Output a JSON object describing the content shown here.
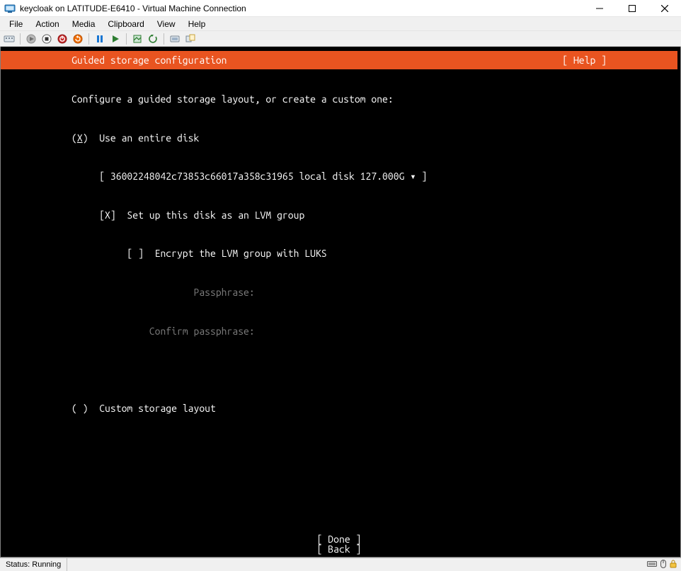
{
  "window": {
    "title": "keycloak on LATITUDE-E6410 - Virtual Machine Connection"
  },
  "menu": {
    "items": [
      "File",
      "Action",
      "Media",
      "Clipboard",
      "View",
      "Help"
    ]
  },
  "toolbar": {
    "icons": [
      "ctrl-alt-del-icon",
      "sep",
      "start-grey-icon",
      "stop-icon",
      "shutdown-icon",
      "reset-icon",
      "sep",
      "pause-icon",
      "resume-icon",
      "sep",
      "checkpoint-icon",
      "revert-icon",
      "sep",
      "enhanced-session-icon",
      "share-icon"
    ]
  },
  "installer": {
    "header_title": "Guided storage configuration",
    "header_help": "[ Help ]",
    "intro": "Configure a guided storage layout, or create a custom one:",
    "opt_entire_marker_pre": "(",
    "opt_entire_marker_key": "X",
    "opt_entire_marker_post": ")",
    "opt_entire_label": "Use an entire disk",
    "disk_select": "[ 36002248042c73853c66017a358c31965 local disk 127.000G ▾ ]",
    "lvm_check": "[X]  Set up this disk as an LVM group",
    "luks_check": "[ ]  Encrypt the LVM group with LUKS",
    "passphrase_label": "Passphrase:",
    "confirm_label": "Confirm passphrase:",
    "opt_custom_marker": "( )",
    "opt_custom_label": "Custom storage layout",
    "done": "[ Done       ]",
    "back": "[ Back       ]"
  },
  "status": {
    "text": "Status: Running"
  },
  "colors": {
    "accent": "#e95420",
    "term_bg": "#000000",
    "term_fg": "#ffffff",
    "dim": "#7f7f7f"
  }
}
